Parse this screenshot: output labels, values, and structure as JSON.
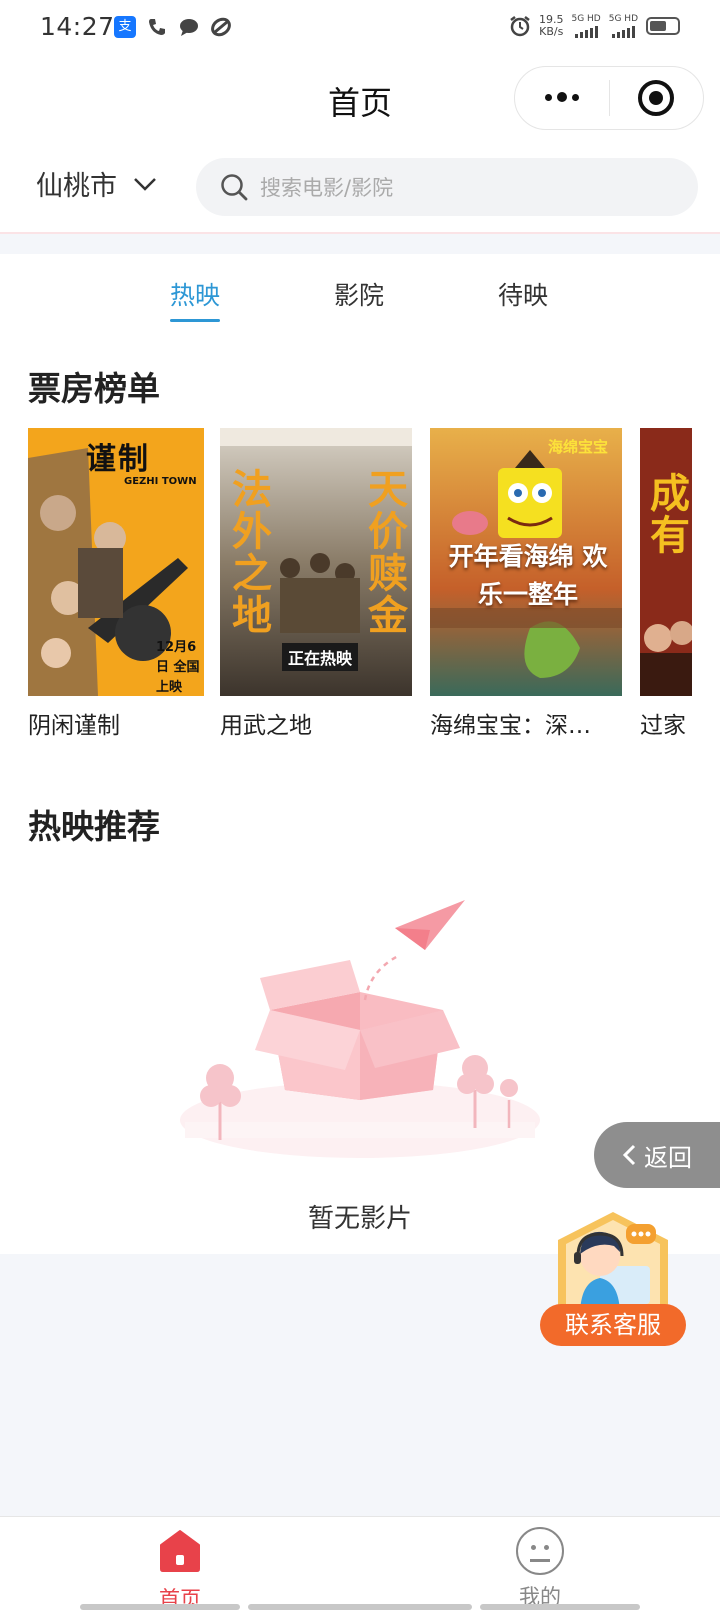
{
  "status_bar": {
    "time": "14:27",
    "net_speed_value": "19.5",
    "net_speed_unit": "KB/s",
    "sim1": "5G HD",
    "sim2": "5G HD",
    "alipay_glyph": "支"
  },
  "header": {
    "title": "首页"
  },
  "search": {
    "city": "仙桃市",
    "placeholder": "搜索电影/影院"
  },
  "tabs": [
    {
      "label": "热映",
      "active": true
    },
    {
      "label": "影院",
      "active": false
    },
    {
      "label": "待映",
      "active": false
    }
  ],
  "box_office": {
    "title": "票房榜单",
    "movies": [
      {
        "name": "阴闲谨制",
        "poster_text": "谨制",
        "poster_sub": "GEZHI TOWN",
        "poster_date": "12月6日 全国上映",
        "color": "#f3a51c"
      },
      {
        "name": "用武之地",
        "poster_text_left": "法外之地",
        "poster_text_right": "天价赎金",
        "poster_badge": "正在热映",
        "color": "#8c7a62"
      },
      {
        "name": "海绵宝宝：深…",
        "poster_text": "开年看海绵 欢乐一整年",
        "poster_badge": "海绵宝宝",
        "color": "#d77a2a"
      },
      {
        "name": "过家",
        "poster_text": "成有",
        "color": "#a8402a"
      }
    ]
  },
  "recommend": {
    "title": "热映推荐",
    "empty_text": "暂无影片"
  },
  "floating": {
    "back_label": "返回",
    "service_label": "联系客服"
  },
  "tabbar": [
    {
      "label": "首页",
      "active": true,
      "icon": "home-icon"
    },
    {
      "label": "我的",
      "active": false,
      "icon": "smiley-icon"
    }
  ],
  "colors": {
    "accent": "#2d97d5",
    "tabbar_active": "#e8424a",
    "service": "#f26a2a"
  }
}
